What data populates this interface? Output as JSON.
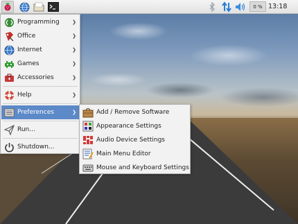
{
  "taskbar": {
    "launchers": [
      {
        "icon": "raspberry-icon"
      },
      {
        "icon": "web-browser-icon"
      },
      {
        "icon": "file-manager-icon"
      },
      {
        "icon": "terminal-icon"
      }
    ],
    "tray": {
      "bluetooth_icon": "bluetooth-icon",
      "network_icon": "network-arrows-icon",
      "volume_icon": "volume-icon",
      "cpu_label": "0 %",
      "clock": "13:18"
    }
  },
  "main_menu": {
    "items": [
      {
        "label": "Programming",
        "icon": "programming-icon",
        "submenu": true
      },
      {
        "label": "Office",
        "icon": "office-icon",
        "submenu": true
      },
      {
        "label": "Internet",
        "icon": "internet-icon",
        "submenu": true
      },
      {
        "label": "Games",
        "icon": "games-icon",
        "submenu": true
      },
      {
        "label": "Accessories",
        "icon": "accessories-icon",
        "submenu": true
      },
      {
        "label": "Help",
        "icon": "help-icon",
        "submenu": true
      },
      {
        "label": "Preferences",
        "icon": "preferences-icon",
        "submenu": true,
        "selected": true
      },
      {
        "label": "Run...",
        "icon": "run-icon",
        "submenu": false
      },
      {
        "label": "Shutdown...",
        "icon": "shutdown-icon",
        "submenu": false
      }
    ]
  },
  "preferences_menu": {
    "items": [
      {
        "label": "Add / Remove Software",
        "icon": "software-package-icon"
      },
      {
        "label": "Appearance Settings",
        "icon": "appearance-icon"
      },
      {
        "label": "Audio Device Settings",
        "icon": "audio-device-icon"
      },
      {
        "label": "Main Menu Editor",
        "icon": "menu-editor-icon"
      },
      {
        "label": "Mouse and Keyboard Settings",
        "icon": "keyboard-icon"
      }
    ]
  },
  "colors": {
    "selection": "#5c89c8",
    "menu_bg": "#f2f2f2",
    "taskbar_bg": "#e8e8e8"
  }
}
